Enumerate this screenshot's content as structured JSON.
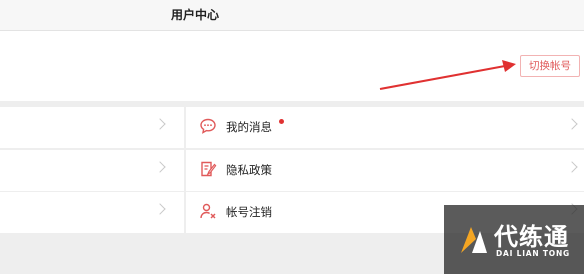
{
  "header": {
    "title": "用户中心"
  },
  "profile": {
    "switch_account_label": "切换帐号"
  },
  "menu_right": [
    {
      "label": "我的消息",
      "icon": "message-icon",
      "badge_dot": true
    },
    {
      "label": "隐私政策",
      "icon": "policy-icon"
    },
    {
      "label": "帐号注销",
      "icon": "account-cancel-icon"
    }
  ],
  "watermark": {
    "name": "代练通",
    "subtitle": "DAI LIAN TONG"
  },
  "colors": {
    "accent": "#e05a5a",
    "arrow": "#e03131",
    "watermark_orange": "#f5a623"
  }
}
